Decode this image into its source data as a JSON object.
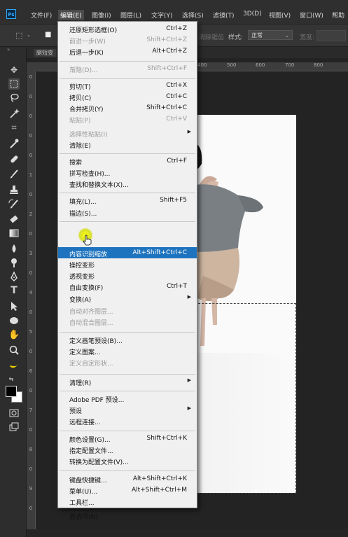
{
  "app": {
    "logo": "Ps"
  },
  "menubar": {
    "items": [
      "文件(F)",
      "编辑(E)",
      "图像(I)",
      "图层(L)",
      "文字(Y)",
      "选择(S)",
      "滤镜(T)",
      "3D(D)",
      "视图(V)",
      "窗口(W)",
      "帮助"
    ],
    "active_index": 1
  },
  "options_bar": {
    "faded_label": "消除锯齿",
    "style_label": "样式:",
    "style_value": "正常",
    "width_label": "宽度:"
  },
  "document": {
    "tab_label": "腿短变",
    "ruler_h": [
      "400",
      "500",
      "600",
      "700",
      "800"
    ],
    "ruler_v": [
      "0",
      "0",
      "0",
      "0",
      "0",
      "1",
      "0",
      "2",
      "0",
      "3",
      "0",
      "4",
      "0",
      "5",
      "0",
      "6",
      "0",
      "7",
      "0",
      "8",
      "0",
      "9",
      "0"
    ]
  },
  "edit_menu": {
    "items": [
      {
        "label": "还原矩形选框(O)",
        "shortcut": "Ctrl+Z",
        "disabled": false
      },
      {
        "label": "前进一步(W)",
        "shortcut": "Shift+Ctrl+Z",
        "disabled": true
      },
      {
        "label": "后退一步(K)",
        "shortcut": "Alt+Ctrl+Z",
        "disabled": false
      },
      {
        "label": "渐隐(D)...",
        "shortcut": "Shift+Ctrl+F",
        "disabled": true
      },
      {
        "label": "剪切(T)",
        "shortcut": "Ctrl+X",
        "disabled": false
      },
      {
        "label": "拷贝(C)",
        "shortcut": "Ctrl+C",
        "disabled": false
      },
      {
        "label": "合并拷贝(Y)",
        "shortcut": "Shift+Ctrl+C",
        "disabled": false
      },
      {
        "label": "粘贴(P)",
        "shortcut": "Ctrl+V",
        "disabled": true
      },
      {
        "label": "选择性粘贴(I)",
        "shortcut": "",
        "disabled": true,
        "submenu": true
      },
      {
        "label": "清除(E)",
        "shortcut": "",
        "disabled": false
      },
      {
        "label": "搜索",
        "shortcut": "Ctrl+F",
        "disabled": false
      },
      {
        "label": "拼写检查(H)...",
        "shortcut": "",
        "disabled": false
      },
      {
        "label": "查找和替换文本(X)...",
        "shortcut": "",
        "disabled": false
      },
      {
        "label": "填充(L)...",
        "shortcut": "Shift+F5",
        "disabled": false
      },
      {
        "label": "描边(S)...",
        "shortcut": "",
        "disabled": false
      },
      {
        "label": "内容识别缩放",
        "shortcut": "Alt+Shift+Ctrl+C",
        "disabled": false,
        "highlighted": true
      },
      {
        "label": "操控变形",
        "shortcut": "",
        "disabled": false
      },
      {
        "label": "透视变形",
        "shortcut": "",
        "disabled": false
      },
      {
        "label": "自由变换(F)",
        "shortcut": "Ctrl+T",
        "disabled": false
      },
      {
        "label": "变换(A)",
        "shortcut": "",
        "disabled": false,
        "submenu": true
      },
      {
        "label": "自动对齐图层...",
        "shortcut": "",
        "disabled": true
      },
      {
        "label": "自动混合图层...",
        "shortcut": "",
        "disabled": true
      },
      {
        "label": "定义画笔预设(B)...",
        "shortcut": "",
        "disabled": false
      },
      {
        "label": "定义图案...",
        "shortcut": "",
        "disabled": false
      },
      {
        "label": "定义自定形状...",
        "shortcut": "",
        "disabled": true
      },
      {
        "label": "清理(R)",
        "shortcut": "",
        "disabled": false,
        "submenu": true
      },
      {
        "label": "Adobe PDF 预设...",
        "shortcut": "",
        "disabled": false
      },
      {
        "label": "预设",
        "shortcut": "",
        "disabled": false,
        "submenu": true
      },
      {
        "label": "远程连接...",
        "shortcut": "",
        "disabled": false
      },
      {
        "label": "颜色设置(G)...",
        "shortcut": "Shift+Ctrl+K",
        "disabled": false
      },
      {
        "label": "指定配置文件...",
        "shortcut": "",
        "disabled": false
      },
      {
        "label": "转换为配置文件(V)...",
        "shortcut": "",
        "disabled": false
      },
      {
        "label": "键盘快捷键...",
        "shortcut": "Alt+Shift+Ctrl+K",
        "disabled": false
      },
      {
        "label": "菜单(U)...",
        "shortcut": "Alt+Shift+Ctrl+M",
        "disabled": false
      },
      {
        "label": "工具栏...",
        "shortcut": "",
        "disabled": false
      },
      {
        "label": "首选项(N)",
        "shortcut": "",
        "disabled": false,
        "submenu": true
      }
    ]
  },
  "colors": {
    "menu_highlight": "#1e73be",
    "menu_bg": "#f0f0f0",
    "menubar_bg": "#2f2f2f",
    "workspace_bg": "#232323"
  },
  "icons": [
    "move-icon",
    "marquee-icon",
    "lasso-icon",
    "magic-wand-icon",
    "crop-icon",
    "eyedropper-icon",
    "healing-icon",
    "brush-icon",
    "stamp-icon",
    "history-brush-icon",
    "eraser-icon",
    "gradient-icon",
    "blur-icon",
    "dodge-icon",
    "pen-icon",
    "type-icon",
    "path-select-icon",
    "ellipse-icon",
    "hand-icon",
    "zoom-icon",
    "banana-icon",
    "swap-colors-icon",
    "color-swatch-icon",
    "quick-mask-icon",
    "screen-mode-icon"
  ]
}
